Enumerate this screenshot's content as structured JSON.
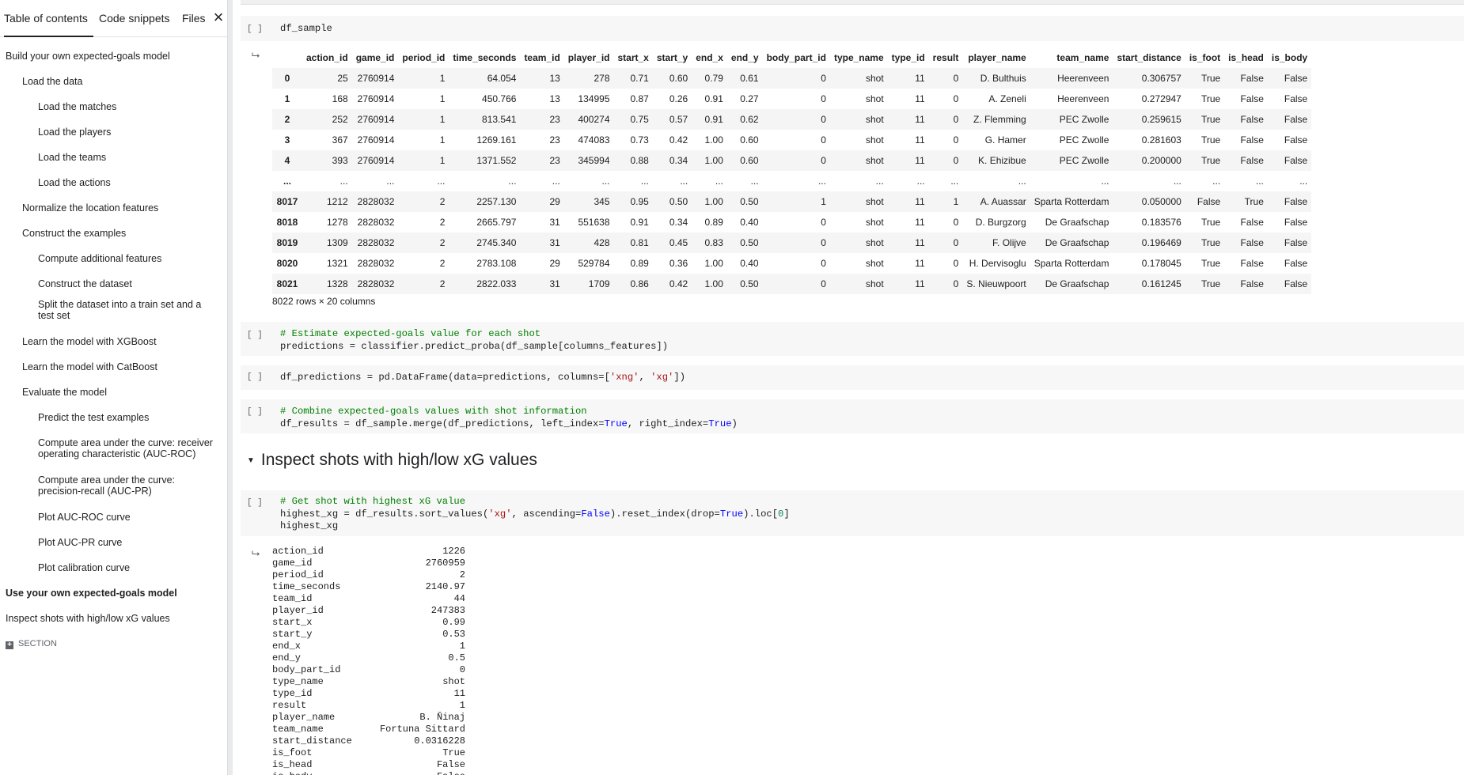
{
  "sidebar": {
    "tabs": [
      {
        "label": "Table of contents"
      },
      {
        "label": "Code snippets"
      },
      {
        "label": "Files"
      }
    ],
    "close_icon": "close-icon",
    "toc": [
      {
        "label": "Build your own expected-goals model",
        "level": 1
      },
      {
        "label": "Load the data",
        "level": 2
      },
      {
        "label": "Load the matches",
        "level": 3
      },
      {
        "label": "Load the players",
        "level": 3
      },
      {
        "label": "Load the teams",
        "level": 3
      },
      {
        "label": "Load the actions",
        "level": 3
      },
      {
        "label": "Normalize the location features",
        "level": 2
      },
      {
        "label": "Construct the examples",
        "level": 2
      },
      {
        "label": "Compute additional features",
        "level": 3
      },
      {
        "label": "Construct the dataset",
        "level": 3
      },
      {
        "label": "Split the dataset into a train set and a test set",
        "level": 3
      },
      {
        "label": "Learn the model with XGBoost",
        "level": 2
      },
      {
        "label": "Learn the model with CatBoost",
        "level": 2
      },
      {
        "label": "Evaluate the model",
        "level": 2
      },
      {
        "label": "Predict the test examples",
        "level": 3
      },
      {
        "label": "Compute area under the curve: receiver operating characteristic (AUC-ROC)",
        "level": 3
      },
      {
        "label": "Compute area under the curve: precision-recall (AUC-PR)",
        "level": 3
      },
      {
        "label": "Plot AUC-ROC curve",
        "level": 3
      },
      {
        "label": "Plot AUC-PR curve",
        "level": 3
      },
      {
        "label": "Plot calibration curve",
        "level": 3
      },
      {
        "label": "Use your own expected-goals model",
        "level": 1,
        "bold": true
      },
      {
        "label": "Inspect shots with high/low xG values",
        "level": 1
      }
    ],
    "add_section_label": "SECTION"
  },
  "notebook": {
    "bracket": "[ ]",
    "cell_sample": {
      "code": "df_sample"
    },
    "dataframe": {
      "columns": [
        "action_id",
        "game_id",
        "period_id",
        "time_seconds",
        "team_id",
        "player_id",
        "start_x",
        "start_y",
        "end_x",
        "end_y",
        "body_part_id",
        "type_name",
        "type_id",
        "result",
        "player_name",
        "team_name",
        "start_distance",
        "is_foot",
        "is_head",
        "is_body"
      ],
      "rows": [
        {
          "index": "0",
          "cells": [
            "25",
            "2760914",
            "1",
            "64.054",
            "13",
            "278",
            "0.71",
            "0.60",
            "0.79",
            "0.61",
            "0",
            "shot",
            "11",
            "0",
            "D. Bulthuis",
            "Heerenveen",
            "0.306757",
            "True",
            "False",
            "False"
          ]
        },
        {
          "index": "1",
          "cells": [
            "168",
            "2760914",
            "1",
            "450.766",
            "13",
            "134995",
            "0.87",
            "0.26",
            "0.91",
            "0.27",
            "0",
            "shot",
            "11",
            "0",
            "A. Zeneli",
            "Heerenveen",
            "0.272947",
            "True",
            "False",
            "False"
          ]
        },
        {
          "index": "2",
          "cells": [
            "252",
            "2760914",
            "1",
            "813.541",
            "23",
            "400274",
            "0.75",
            "0.57",
            "0.91",
            "0.62",
            "0",
            "shot",
            "11",
            "0",
            "Z. Flemming",
            "PEC Zwolle",
            "0.259615",
            "True",
            "False",
            "False"
          ]
        },
        {
          "index": "3",
          "cells": [
            "367",
            "2760914",
            "1",
            "1269.161",
            "23",
            "474083",
            "0.73",
            "0.42",
            "1.00",
            "0.60",
            "0",
            "shot",
            "11",
            "0",
            "G. Hamer",
            "PEC Zwolle",
            "0.281603",
            "True",
            "False",
            "False"
          ]
        },
        {
          "index": "4",
          "cells": [
            "393",
            "2760914",
            "1",
            "1371.552",
            "23",
            "345994",
            "0.88",
            "0.34",
            "1.00",
            "0.60",
            "0",
            "shot",
            "11",
            "0",
            "K. Ehizibue",
            "PEC Zwolle",
            "0.200000",
            "True",
            "False",
            "False"
          ]
        },
        {
          "index": "...",
          "cells": [
            "...",
            "...",
            "...",
            "...",
            "...",
            "...",
            "...",
            "...",
            "...",
            "...",
            "...",
            "...",
            "...",
            "...",
            "...",
            "...",
            "...",
            "...",
            "...",
            "..."
          ]
        },
        {
          "index": "8017",
          "cells": [
            "1212",
            "2828032",
            "2",
            "2257.130",
            "29",
            "345",
            "0.95",
            "0.50",
            "1.00",
            "0.50",
            "1",
            "shot",
            "11",
            "1",
            "A. Auassar",
            "Sparta Rotterdam",
            "0.050000",
            "False",
            "True",
            "False"
          ]
        },
        {
          "index": "8018",
          "cells": [
            "1278",
            "2828032",
            "2",
            "2665.797",
            "31",
            "551638",
            "0.91",
            "0.34",
            "0.89",
            "0.40",
            "0",
            "shot",
            "11",
            "0",
            "D. Burgzorg",
            "De Graafschap",
            "0.183576",
            "True",
            "False",
            "False"
          ]
        },
        {
          "index": "8019",
          "cells": [
            "1309",
            "2828032",
            "2",
            "2745.340",
            "31",
            "428",
            "0.81",
            "0.45",
            "0.83",
            "0.50",
            "0",
            "shot",
            "11",
            "0",
            "F. Olijve",
            "De Graafschap",
            "0.196469",
            "True",
            "False",
            "False"
          ]
        },
        {
          "index": "8020",
          "cells": [
            "1321",
            "2828032",
            "2",
            "2783.108",
            "29",
            "529784",
            "0.89",
            "0.36",
            "1.00",
            "0.40",
            "0",
            "shot",
            "11",
            "0",
            "H. Dervisoglu",
            "Sparta Rotterdam",
            "0.178045",
            "True",
            "False",
            "False"
          ]
        },
        {
          "index": "8021",
          "cells": [
            "1328",
            "2828032",
            "2",
            "2822.033",
            "31",
            "1709",
            "0.86",
            "0.42",
            "1.00",
            "0.50",
            "0",
            "shot",
            "11",
            "0",
            "S. Nieuwpoort",
            "De Graafschap",
            "0.161245",
            "True",
            "False",
            "False"
          ]
        }
      ],
      "shape": "8022 rows × 20 columns"
    },
    "cell_predict": {
      "comment": "# Estimate expected-goals value for each shot",
      "code": "predictions = classifier.predict_proba(df_sample[columns_features])"
    },
    "cell_df_predictions": {
      "pre": "df_predictions = pd.DataFrame(data=predictions, columns=[",
      "str1": "'xng'",
      "sep": ", ",
      "str2": "'xg'",
      "post": "])"
    },
    "cell_merge": {
      "comment": "# Combine expected-goals values with shot information",
      "pre": "df_results = df_sample.merge(df_predictions, left_index=",
      "kw1": "True",
      "mid": ", right_index=",
      "kw2": "True",
      "post": ")"
    },
    "section_heading": "Inspect shots with high/low xG values",
    "cell_highest": {
      "comment": "# Get shot with highest xG value",
      "pre": "highest_xg = df_results.sort_values(",
      "str1": "'xg'",
      "mid1": ", ascending=",
      "kw1": "False",
      "mid2": ").reset_index(drop=",
      "kw2": "True",
      "mid3": ").loc[",
      "num": "0",
      "post": "]",
      "line3": "highest_xg"
    },
    "series_output": [
      {
        "key": "action_id",
        "value": "1226"
      },
      {
        "key": "game_id",
        "value": "2760959"
      },
      {
        "key": "period_id",
        "value": "2"
      },
      {
        "key": "time_seconds",
        "value": "2140.97"
      },
      {
        "key": "team_id",
        "value": "44"
      },
      {
        "key": "player_id",
        "value": "247383"
      },
      {
        "key": "start_x",
        "value": "0.99"
      },
      {
        "key": "start_y",
        "value": "0.53"
      },
      {
        "key": "end_x",
        "value": "1"
      },
      {
        "key": "end_y",
        "value": "0.5"
      },
      {
        "key": "body_part_id",
        "value": "0"
      },
      {
        "key": "type_name",
        "value": "shot"
      },
      {
        "key": "type_id",
        "value": "11"
      },
      {
        "key": "result",
        "value": "1"
      },
      {
        "key": "player_name",
        "value": "B. Ňinaj"
      },
      {
        "key": "team_name",
        "value": "Fortuna Sittard"
      },
      {
        "key": "start_distance",
        "value": "0.0316228"
      },
      {
        "key": "is_foot",
        "value": "True"
      },
      {
        "key": "is_head",
        "value": "False"
      },
      {
        "key": "is_body",
        "value": "False"
      }
    ],
    "output_icon": "output-icon"
  },
  "colors": {
    "comment": "#008000",
    "string": "#a31515",
    "keyword": "#0000ff",
    "number": "#098658",
    "cell_bg": "#f7f7f7"
  }
}
